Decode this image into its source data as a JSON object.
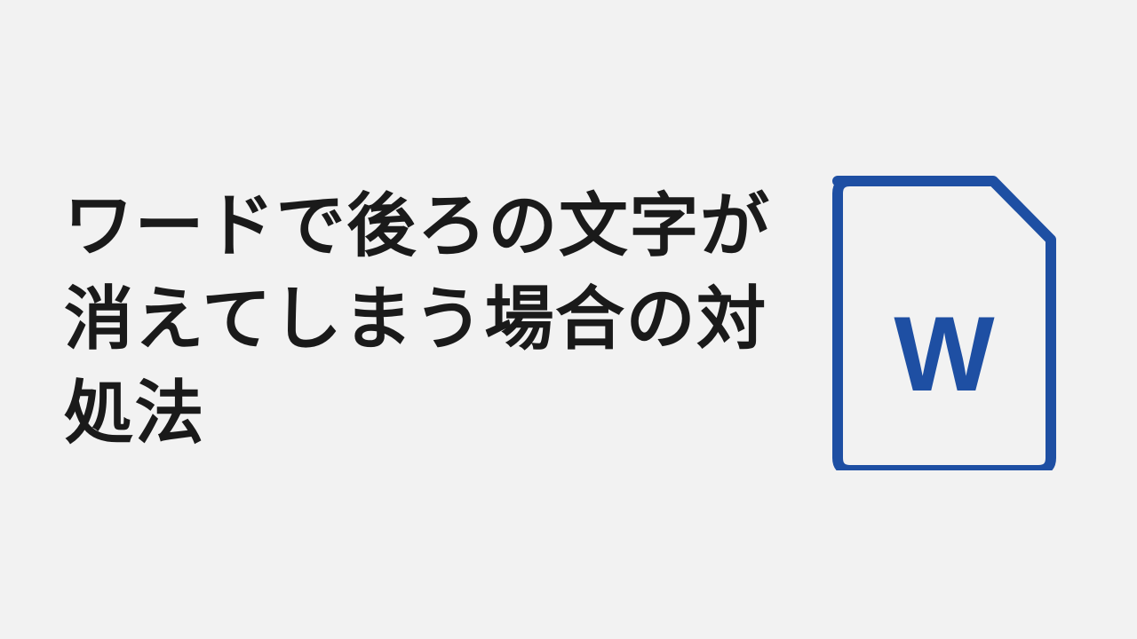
{
  "title": "ワードで後ろの文字が消えてしまう場合の対処法",
  "icon": {
    "letter": "W",
    "color": "#1e4fa3"
  }
}
